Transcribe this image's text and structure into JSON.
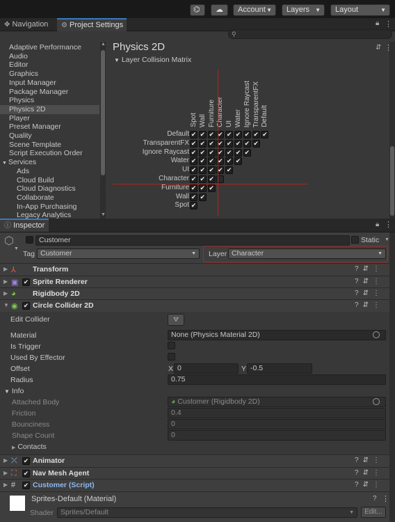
{
  "toolbar": {
    "account": "Account",
    "layers": "Layers",
    "layout": "Layout"
  },
  "tabs": {
    "navigation": "Navigation",
    "project_settings": "Project Settings",
    "inspector": "Inspector"
  },
  "settings_list": [
    "Adaptive Performance",
    "Audio",
    "Editor",
    "Graphics",
    "Input Manager",
    "Package Manager",
    "Physics",
    "Physics 2D",
    "Player",
    "Preset Manager",
    "Quality",
    "Scene Template",
    "Script Execution Order",
    "Services",
    "Ads",
    "Cloud Build",
    "Cloud Diagnostics",
    "Collaborate",
    "In-App Purchasing",
    "Legacy Analytics"
  ],
  "physics": {
    "title": "Physics 2D",
    "section": "Layer Collision Matrix",
    "columns": [
      "Spot",
      "Wall",
      "Furniture",
      "Character",
      "UI",
      "Water",
      "Ignore Raycast",
      "TransparentFX",
      "Default"
    ],
    "rows": [
      "Default",
      "TransparentFX",
      "Ignore Raycast",
      "Water",
      "UI",
      "Character",
      "Furniture",
      "Wall",
      "Spot"
    ]
  },
  "inspector": {
    "object_name": "Customer",
    "static_label": "Static",
    "tag_label": "Tag",
    "tag_value": "Customer",
    "layer_label": "Layer",
    "layer_value": "Character",
    "components": {
      "transform": "Transform",
      "sprite_renderer": "Sprite Renderer",
      "rigidbody": "Rigidbody 2D",
      "circle_collider": "Circle Collider 2D",
      "animator": "Animator",
      "nav_mesh_agent": "Nav Mesh Agent",
      "script": "Customer (Script)"
    },
    "collider": {
      "edit_collider": "Edit Collider",
      "material_label": "Material",
      "material_value": "None (Physics Material 2D)",
      "is_trigger": "Is Trigger",
      "used_by_effector": "Used By Effector",
      "offset_label": "Offset",
      "offset_x_label": "X",
      "offset_x": "0",
      "offset_y_label": "Y",
      "offset_y": "-0.5",
      "radius_label": "Radius",
      "radius_value": "0.75",
      "info_label": "Info",
      "attached_body_label": "Attached Body",
      "attached_body_value": "Customer (Rigidbody 2D)",
      "friction_label": "Friction",
      "friction_value": "0.4",
      "bounciness_label": "Bounciness",
      "bounciness_value": "0",
      "shape_count_label": "Shape Count",
      "shape_count_value": "0",
      "contacts_label": "Contacts"
    },
    "material": {
      "name": "Sprites-Default (Material)",
      "shader_label": "Shader",
      "shader_value": "Sprites/Default",
      "edit_button": "Edit..."
    }
  }
}
